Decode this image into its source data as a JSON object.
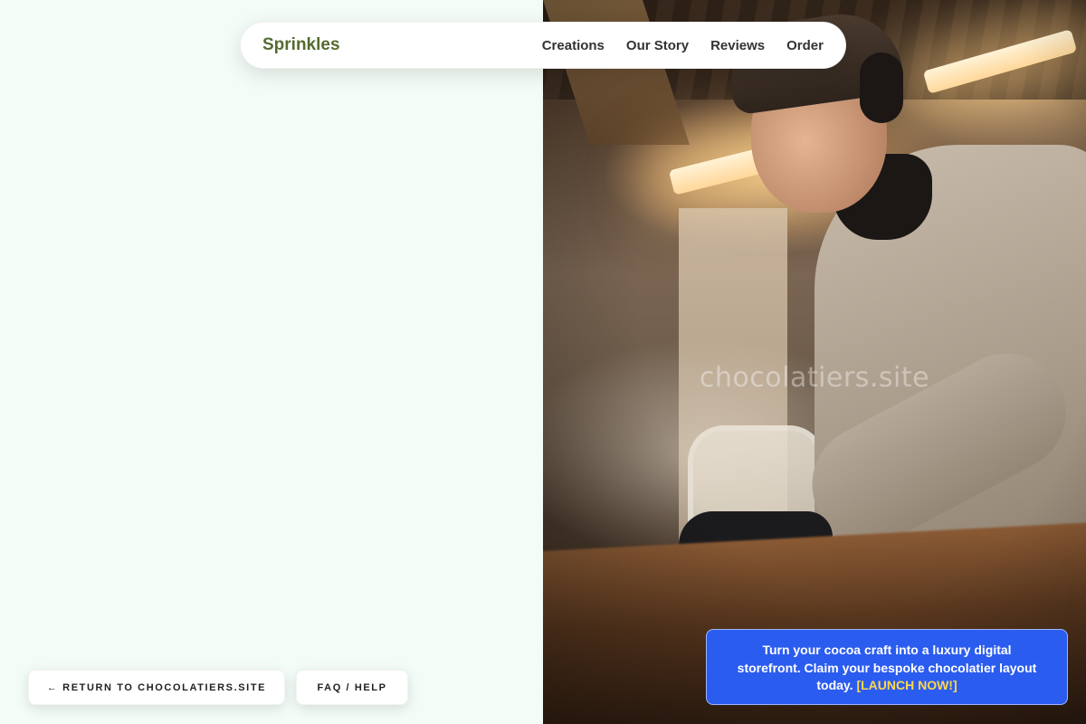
{
  "brand": {
    "name": "Sprinkles",
    "color": "#556b2f"
  },
  "nav": {
    "links": [
      {
        "label": "Creations"
      },
      {
        "label": "Our Story"
      },
      {
        "label": "Reviews"
      },
      {
        "label": "Order"
      }
    ]
  },
  "hero": {
    "watermark": "chocolatiers.site"
  },
  "footer_buttons": {
    "return_label": "← RETURN TO CHOCOLATIERS.SITE",
    "faq_label": "FAQ / HELP"
  },
  "cta": {
    "text": "Turn your cocoa craft into a luxury digital storefront. Claim your bespoke chocolatier layout today.",
    "link_label": "[LAUNCH NOW!]",
    "background": "#2b5cf0",
    "link_color": "#ffd84a"
  },
  "colors": {
    "left_background": "#f3fcf6"
  }
}
